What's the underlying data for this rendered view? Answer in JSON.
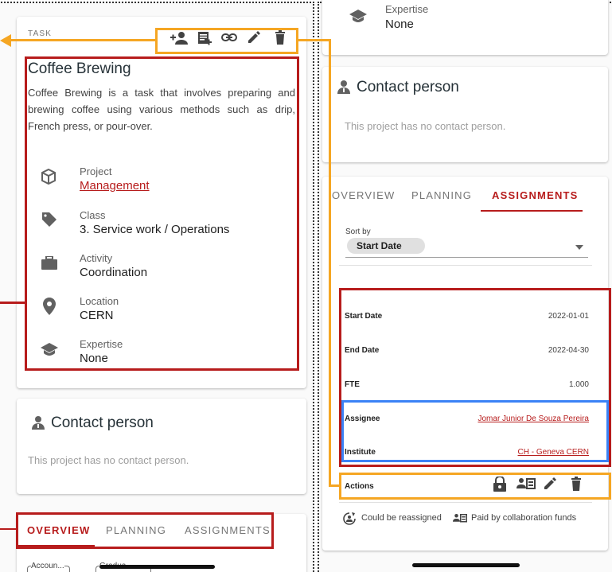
{
  "left": {
    "task_overline": "TASK",
    "task_title": "Coffee Brewing",
    "task_description": "Coffee Brewing is a task that involves preparing and brewing coffee using various methods such as drip, French press, or pour-over.",
    "fields": [
      {
        "label": "Project",
        "value": "Management",
        "icon": "cube-icon"
      },
      {
        "label": "Class",
        "value": "3. Service work / Operations",
        "icon": "tag-icon"
      },
      {
        "label": "Activity",
        "value": "Coordination",
        "icon": "briefcase-icon"
      },
      {
        "label": "Location",
        "value": "CERN",
        "icon": "location-pin-icon"
      },
      {
        "label": "Expertise",
        "value": "None",
        "icon": "graduation-cap-icon"
      }
    ],
    "contact_title": "Contact person",
    "contact_empty": "This project has no contact person.",
    "tabs": [
      "OVERVIEW",
      "PLANNING",
      "ASSIGNMENTS"
    ],
    "filter_chips": [
      "Accoun...",
      "Gradua..."
    ]
  },
  "right": {
    "expertise_label": "Expertise",
    "expertise_value": "None",
    "contact_title": "Contact person",
    "contact_empty": "This project has no contact person.",
    "tabs": [
      "OVERVIEW",
      "PLANNING",
      "ASSIGNMENTS"
    ],
    "sort_label": "Sort by",
    "sort_value": "Start Date",
    "rows": [
      {
        "label": "Start Date",
        "value": "2022-01-01"
      },
      {
        "label": "End Date",
        "value": "2022-04-30"
      },
      {
        "label": "FTE",
        "value": "1.000"
      },
      {
        "label": "Assignee",
        "value": "Jomar Junior De Souza Pereira"
      },
      {
        "label": "Institute",
        "value": "CH - Geneva CERN"
      }
    ],
    "actions_label": "Actions",
    "legend": [
      {
        "text": "Could be reassigned",
        "icon": "reassign-icon"
      },
      {
        "text": "Paid by collaboration funds",
        "icon": "collaboration-funds-icon"
      }
    ]
  },
  "colors": {
    "accent_red": "#b71c1c",
    "annotation_red": "#b71c1c",
    "annotation_orange": "#f5a623",
    "annotation_blue": "#3b82f6"
  }
}
